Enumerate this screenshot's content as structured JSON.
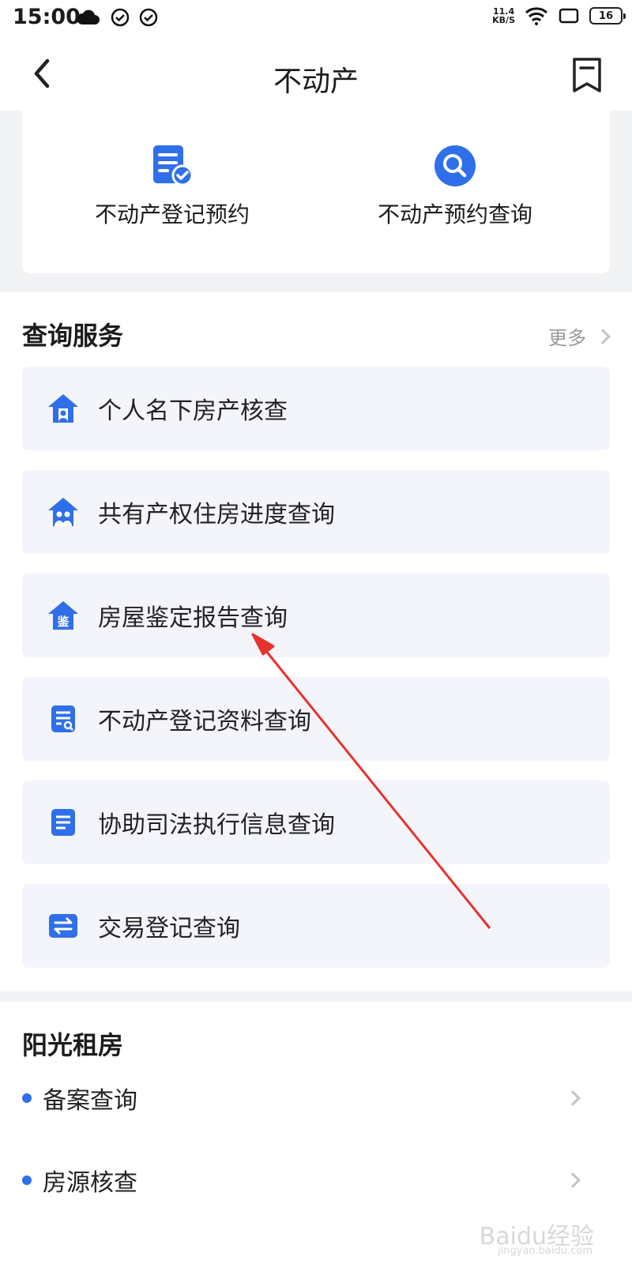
{
  "status_bar": {
    "time": "15:00",
    "net_speed_value": "11.4",
    "net_speed_unit": "KB/S",
    "battery": "16"
  },
  "nav": {
    "title": "不动产",
    "back_icon": "back-arrow-icon",
    "bookmark_icon": "bookmark-icon"
  },
  "quick_actions": [
    {
      "label": "不动产登记预约",
      "icon": "doc-check-icon"
    },
    {
      "label": "不动产预约查询",
      "icon": "search-icon"
    }
  ],
  "query_services": {
    "title": "查询服务",
    "more_label": "更多",
    "items": [
      {
        "label": "个人名下房产核查",
        "icon": "house-person-icon"
      },
      {
        "label": "共有产权住房进度查询",
        "icon": "house-people-icon"
      },
      {
        "label": "房屋鉴定报告查询",
        "icon": "house-appraisal-icon",
        "icon_text": "鉴"
      },
      {
        "label": "不动产登记资料查询",
        "icon": "doc-search-icon"
      },
      {
        "label": "协助司法执行信息查询",
        "icon": "document-icon"
      },
      {
        "label": "交易登记查询",
        "icon": "exchange-icon"
      }
    ]
  },
  "sunshine_rental": {
    "title": "阳光租房",
    "items": [
      {
        "label": "备案查询"
      },
      {
        "label": "房源核查"
      }
    ]
  },
  "watermark": {
    "text": "Baidu经验",
    "sub": "jingyan.baidu.com"
  },
  "colors": {
    "accent": "#2f6fea",
    "annotation_arrow": "#e8322b"
  }
}
